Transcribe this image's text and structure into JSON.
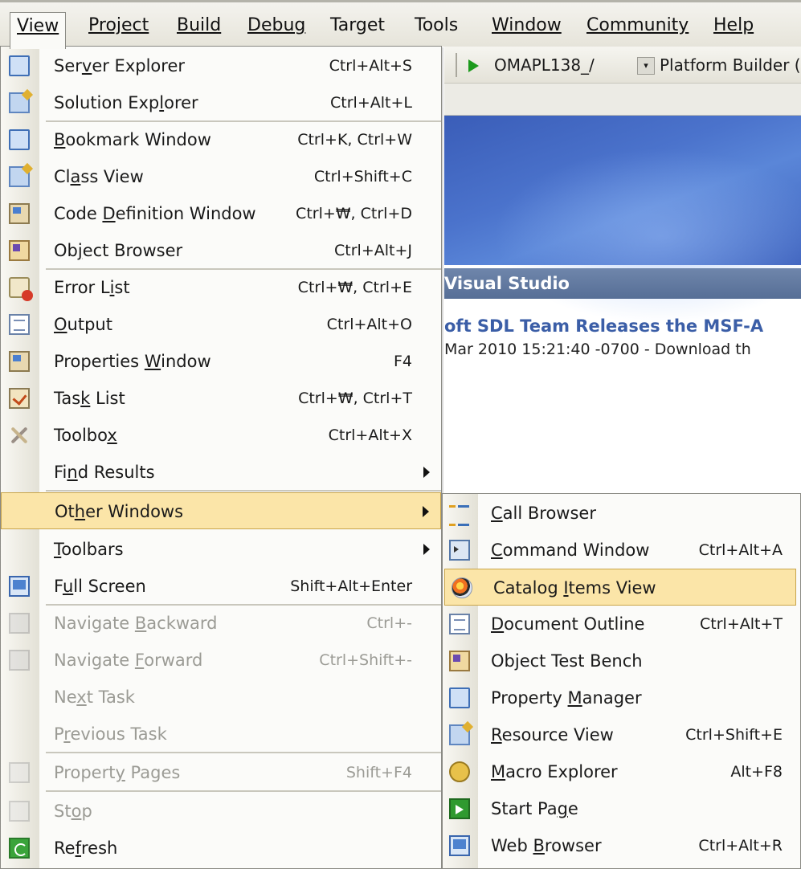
{
  "menubar": {
    "items": [
      "View",
      "Project",
      "Build",
      "Debug",
      "Target",
      "Tools",
      "Window",
      "Community",
      "Help"
    ]
  },
  "background": {
    "config_combo": "OMAPL138_/",
    "config_arrow": "▾",
    "platform": "Platform Builder (",
    "panel_header": "Visual Studio",
    "news_title": "oft SDL Team Releases the MSF-A",
    "news_sub": "Mar 2010 15:21:40 -0700 -  Download th"
  },
  "view_menu": {
    "items": [
      {
        "pre": "Ser",
        "u": "v",
        "post": "er Explorer",
        "shortcut": "Ctrl+Alt+S"
      },
      {
        "pre": "Solution Exp",
        "u": "l",
        "post": "orer",
        "shortcut": "Ctrl+Alt+L"
      },
      {
        "pre": "",
        "u": "B",
        "post": "ookmark Window",
        "shortcut": "Ctrl+K, Ctrl+W"
      },
      {
        "pre": "Cl",
        "u": "a",
        "post": "ss View",
        "shortcut": "Ctrl+Shift+C"
      },
      {
        "pre": "Code ",
        "u": "D",
        "post": "efinition Window",
        "shortcut": "Ctrl+₩, Ctrl+D"
      },
      {
        "pre": "Ob",
        "u": "j",
        "post": "ect Browser",
        "shortcut": "Ctrl+Alt+J"
      },
      {
        "pre": "Error L",
        "u": "i",
        "post": "st",
        "shortcut": "Ctrl+₩, Ctrl+E"
      },
      {
        "pre": "",
        "u": "O",
        "post": "utput",
        "shortcut": "Ctrl+Alt+O"
      },
      {
        "pre": "Properties ",
        "u": "W",
        "post": "indow",
        "shortcut": "F4"
      },
      {
        "pre": "Tas",
        "u": "k",
        "post": " List",
        "shortcut": "Ctrl+₩, Ctrl+T"
      },
      {
        "pre": "Toolbo",
        "u": "x",
        "post": "",
        "shortcut": "Ctrl+Alt+X"
      },
      {
        "pre": "Fi",
        "u": "n",
        "post": "d Results",
        "shortcut": ""
      },
      {
        "pre": "Ot",
        "u": "h",
        "post": "er Windows",
        "shortcut": ""
      },
      {
        "pre": "",
        "u": "T",
        "post": "oolbars",
        "shortcut": ""
      },
      {
        "pre": "F",
        "u": "u",
        "post": "ll Screen",
        "shortcut": "Shift+Alt+Enter"
      },
      {
        "pre": "Navigate ",
        "u": "B",
        "post": "ackward",
        "shortcut": "Ctrl+-"
      },
      {
        "pre": "Navigate ",
        "u": "F",
        "post": "orward",
        "shortcut": "Ctrl+Shift+-"
      },
      {
        "pre": "Ne",
        "u": "x",
        "post": "t Task",
        "shortcut": ""
      },
      {
        "pre": "P",
        "u": "r",
        "post": "evious Task",
        "shortcut": ""
      },
      {
        "pre": "Propert",
        "u": "y",
        "post": " Pages",
        "shortcut": "Shift+F4"
      },
      {
        "pre": "St",
        "u": "o",
        "post": "p",
        "shortcut": ""
      },
      {
        "pre": "Re",
        "u": "f",
        "post": "resh",
        "shortcut": ""
      }
    ]
  },
  "other_windows_menu": {
    "items": [
      {
        "pre": "",
        "u": "C",
        "post": "all Browser",
        "shortcut": ""
      },
      {
        "pre": "",
        "u": "C",
        "post": "ommand Window",
        "shortcut": "Ctrl+Alt+A"
      },
      {
        "pre": "Catalog ",
        "u": "I",
        "post": "tems View",
        "shortcut": ""
      },
      {
        "pre": "",
        "u": "D",
        "post": "ocument Outline",
        "shortcut": "Ctrl+Alt+T"
      },
      {
        "pre": "Object Test Bench",
        "u": "",
        "post": "",
        "shortcut": ""
      },
      {
        "pre": "Property ",
        "u": "M",
        "post": "anager",
        "shortcut": ""
      },
      {
        "pre": "",
        "u": "R",
        "post": "esource View",
        "shortcut": "Ctrl+Shift+E"
      },
      {
        "pre": "",
        "u": "M",
        "post": "acro Explorer",
        "shortcut": "Alt+F8"
      },
      {
        "pre": "Start Pa",
        "u": "g",
        "post": "e",
        "shortcut": ""
      },
      {
        "pre": "Web ",
        "u": "B",
        "post": "rowser",
        "shortcut": "Ctrl+Alt+R"
      }
    ]
  },
  "colors": {
    "highlight": "#fbe5a8",
    "highlight_border": "#c9a54a",
    "banner": "#4b73cc",
    "panel_header": "#566e96"
  }
}
